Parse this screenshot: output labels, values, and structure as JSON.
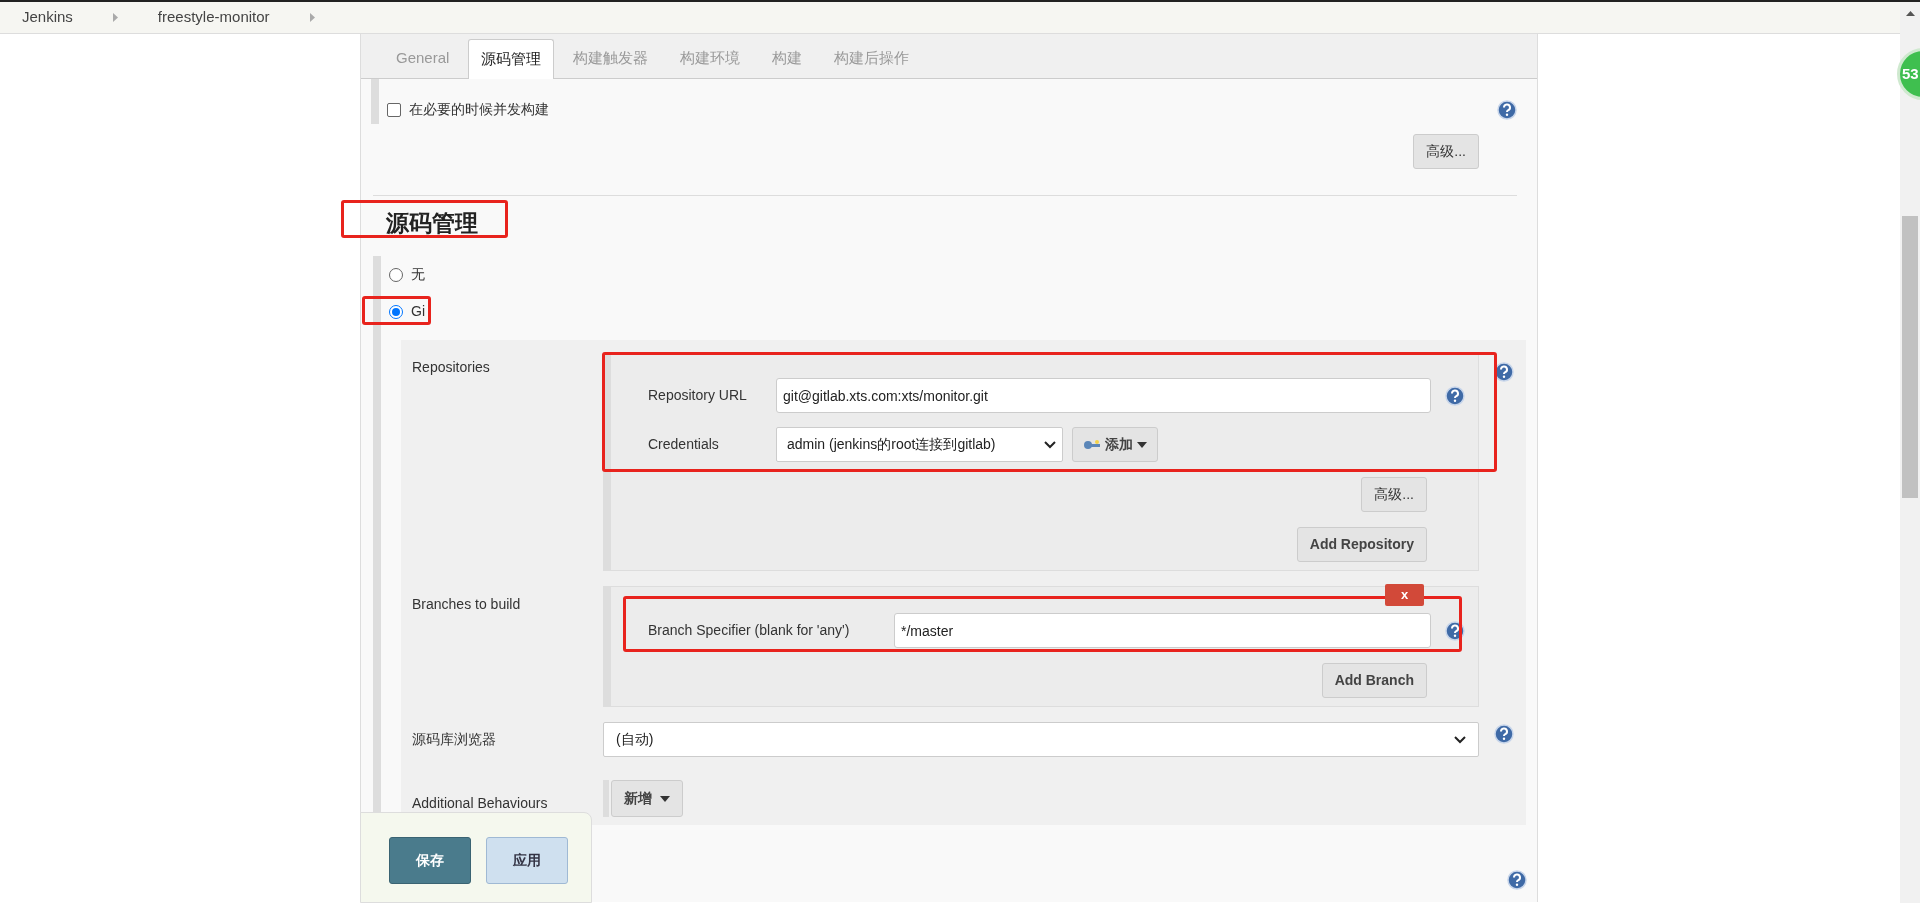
{
  "breadcrumbs": [
    {
      "label": "Jenkins"
    },
    {
      "label": "freestyle-monitor"
    }
  ],
  "tabs": [
    {
      "label": "General",
      "selected": false
    },
    {
      "label": "源码管理",
      "selected": true
    },
    {
      "label": "构建触发器",
      "selected": false
    },
    {
      "label": "构建环境",
      "selected": false
    },
    {
      "label": "构建",
      "selected": false
    },
    {
      "label": "构建后操作",
      "selected": false
    }
  ],
  "options": [
    {
      "label": "在必要的时候并发构建",
      "checked": false
    }
  ],
  "advanced_button": "高级...",
  "section_title": "源码管理",
  "scm_options": [
    {
      "label": "无",
      "selected": false
    },
    {
      "label": "Gi",
      "selected": true
    }
  ],
  "repositories": {
    "label": "Repositories",
    "url_label": "Repository URL",
    "url": "git@gitlab.xts.com:xts/monitor.git",
    "credentials_label": "Credentials",
    "credentials": "admin (jenkins的root连接到gitlab)",
    "add_button": "添加",
    "advanced_button": "高级...",
    "add_repository_button": "Add Repository"
  },
  "branches": {
    "label": "Branches to build",
    "delete_button": "x",
    "specifier_label": "Branch Specifier (blank for 'any')",
    "specifier": "*/master",
    "add_branch_button": "Add Branch"
  },
  "repository_browser": {
    "label": "源码库浏览器",
    "value": "(自动)"
  },
  "additional_behaviours": {
    "label": "Additional Behaviours",
    "button": "新增"
  },
  "save_bar": [
    {
      "label": "保存",
      "kind": "primary"
    },
    {
      "label": "应用",
      "kind": "secondary"
    }
  ],
  "notification_badge": "53"
}
